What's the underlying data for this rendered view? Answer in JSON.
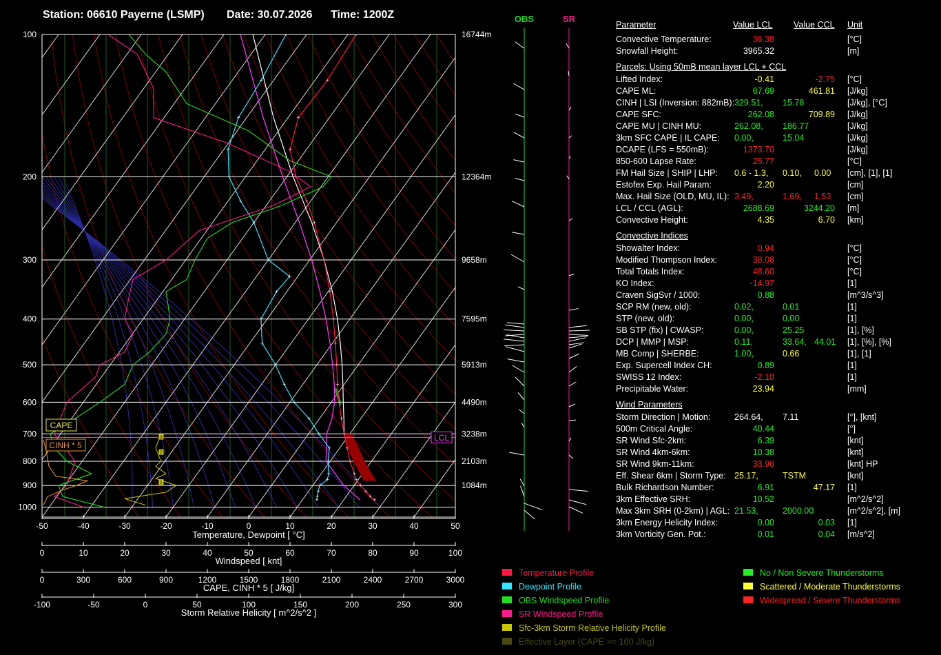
{
  "header": {
    "station": "Station: 06610 Payerne (LSMP)",
    "date": "Date: 30.07.2026",
    "time": "Time: 1200Z"
  },
  "colors": {
    "temperature": "#ff1744",
    "dewpoint": "#33e6ff",
    "obs_wind": "#22dd22",
    "sr_wind": "#ff1a8c",
    "srh": "#c8c800",
    "effective_layer": "#4a4a10",
    "green": "#22ee22",
    "yellow": "#ffff33",
    "red": "#ff2222",
    "parcel": "#ff33ff",
    "cape_fill": "#990000"
  },
  "chart_data": {
    "type": "skew-t",
    "title": "",
    "pressure_levels": [
      100,
      200,
      300,
      400,
      500,
      600,
      700,
      800,
      900,
      1000
    ],
    "height_labels": [
      {
        "p": 100,
        "label": "16744m"
      },
      {
        "p": 200,
        "label": "12364m"
      },
      {
        "p": 300,
        "label": "9658m"
      },
      {
        "p": 400,
        "label": "7595m"
      },
      {
        "p": 500,
        "label": "5913m"
      },
      {
        "p": 600,
        "label": "4490m"
      },
      {
        "p": 700,
        "label": "3238m"
      },
      {
        "p": 800,
        "label": "2103m"
      },
      {
        "p": 900,
        "label": "1084m"
      }
    ],
    "xlim": [
      -50,
      50
    ],
    "x_ticks": [
      -50,
      -40,
      -30,
      -20,
      -10,
      0,
      10,
      20,
      30,
      40,
      50
    ],
    "xlabel": "Temperature, Dewpoint  [ °C]",
    "axis_windspeed": {
      "label": "Windspeed  [ knt]",
      "ticks": [
        0,
        10,
        20,
        30,
        40,
        50,
        60,
        70,
        80,
        90,
        100
      ]
    },
    "axis_cape": {
      "label": "CAPE, CINH * 5  [ J/kg]",
      "ticks": [
        0,
        300,
        600,
        900,
        1200,
        1500,
        1800,
        2100,
        2400,
        2700,
        3000
      ]
    },
    "axis_srh": {
      "label": "Storm Relative Helicity  [ m^2/s^2 ]",
      "ticks": [
        -100,
        -50,
        0,
        50,
        100,
        150,
        200,
        250,
        300
      ]
    },
    "series": [
      {
        "name": "Temperature Profile",
        "points": [
          [
            966,
            27.5
          ],
          [
            950,
            25.8
          ],
          [
            925,
            23.8
          ],
          [
            900,
            21.6
          ],
          [
            875,
            19.5
          ],
          [
            850,
            18.0
          ],
          [
            800,
            14.8
          ],
          [
            750,
            11.8
          ],
          [
            700,
            8.6
          ],
          [
            650,
            5.3
          ],
          [
            600,
            1.9
          ],
          [
            550,
            -1.6
          ],
          [
            500,
            -5.2
          ],
          [
            450,
            -9.3
          ],
          [
            400,
            -14.0
          ],
          [
            350,
            -19.6
          ],
          [
            300,
            -26.5
          ],
          [
            250,
            -35.4
          ],
          [
            225,
            -41.0
          ],
          [
            200,
            -47.8
          ],
          [
            175,
            -54.0
          ],
          [
            150,
            -57.5
          ],
          [
            125,
            -57.0
          ],
          [
            100,
            -58.0
          ]
        ]
      },
      {
        "name": "Dewpoint Profile",
        "points": [
          [
            966,
            13.5
          ],
          [
            950,
            13.0
          ],
          [
            925,
            12.3
          ],
          [
            900,
            11.7
          ],
          [
            875,
            12.5
          ],
          [
            850,
            11.8
          ],
          [
            800,
            9.5
          ],
          [
            750,
            7.5
          ],
          [
            700,
            2.5
          ],
          [
            650,
            -2.5
          ],
          [
            600,
            -9.0
          ],
          [
            550,
            -14.5
          ],
          [
            500,
            -20.0
          ],
          [
            450,
            -27.0
          ],
          [
            400,
            -31.5
          ],
          [
            350,
            -32.5
          ],
          [
            325,
            -32.0
          ],
          [
            300,
            -40.0
          ],
          [
            250,
            -50.0
          ],
          [
            225,
            -57.0
          ],
          [
            200,
            -64.0
          ],
          [
            175,
            -69.0
          ],
          [
            150,
            -72.0
          ],
          [
            125,
            -73.0
          ],
          [
            100,
            -75.0
          ]
        ]
      }
    ],
    "lcl_label": "LCL",
    "cape_label": "CAPE",
    "cinh_label": "CINH * 5"
  },
  "hodograph": {
    "obs_label": "OBS",
    "sr_label": "SR"
  },
  "table": {
    "head": {
      "param": "Parameter",
      "lcl": "Value LCL",
      "ccl": "Value CCL",
      "unit": "Unit"
    },
    "groups": [
      {
        "rows": [
          {
            "label": "Convective Temperature:",
            "v1": "36.38",
            "c1": "red",
            "v2": "",
            "c2": "",
            "unit": "[°C]"
          },
          {
            "label": "Snowfall Height:",
            "v1": "3965.32",
            "c1": "white",
            "v2": "",
            "c2": "",
            "unit": "[m]"
          }
        ]
      },
      {
        "title": "Parcels: Using 50mB mean layer LCL + CCL",
        "rows": [
          {
            "label": "Lifted Index:",
            "v1": "-0.41",
            "c1": "yellow",
            "v2": "-2.75",
            "c2": "red",
            "unit": "[°C]"
          },
          {
            "label": "CAPE ML:",
            "v1": "67.69",
            "c1": "green",
            "v2": "461.81",
            "c2": "yellow",
            "unit": "[J/kg]"
          },
          {
            "label": "CINH | LSI (Inversion: 882mB):",
            "v1": "329.51,",
            "c1": "green",
            "v1b": "15.78",
            "unit": "[J/kg], [°C]"
          },
          {
            "label": "CAPE SFC:",
            "v1": "262.08",
            "c1": "green",
            "v2": "709.89",
            "c2": "yellow",
            "unit": "[J/kg]"
          },
          {
            "label": "CAPE MU | CINH MU:",
            "v1": "262.08,",
            "c1": "green",
            "v1b": "186.77",
            "unit": "[J/kg]"
          },
          {
            "label": "3km SFC CAPE | IL CAPE:",
            "v1": "0.00,",
            "c1": "green",
            "v1b": "15.04",
            "unit": "[J/kg]"
          },
          {
            "label": "DCAPE (LFS = 550mB):",
            "v1": "1373.70",
            "c1": "red",
            "v2": "",
            "c2": "",
            "unit": "[J/kg]"
          },
          {
            "label": "850-600 Lapse Rate:",
            "v1": "25.77",
            "c1": "red",
            "v2": "",
            "c2": "",
            "unit": "[°C]"
          },
          {
            "label": "FM Hail Size | SHIP | LHP:",
            "v1": "0.6 - 1.3,",
            "c1": "yellow",
            "v1b": "0.10,",
            "v1c": "0.00",
            "unit": "[cm], [1], [1]"
          },
          {
            "label": "Estofex Exp. Hail Param:",
            "v1": "2.20",
            "c1": "yellow",
            "v2": "",
            "c2": "",
            "unit": "[cm]"
          },
          {
            "label": "Max. Hail Size (OLD, MU, IL):",
            "v1": "3.49,",
            "c1": "red",
            "v1b": "1.69,",
            "v1c": "1.53",
            "unit": "[cm]"
          },
          {
            "label": "LCL / CCL (AGL):",
            "v1": "2688.69",
            "c1": "green",
            "v2": "3244.20",
            "c2": "green",
            "unit": "[m]"
          },
          {
            "label": "Convective Height:",
            "v1": "4.35",
            "c1": "yellow",
            "v2": "6.70",
            "c2": "yellow",
            "unit": "[km]"
          }
        ]
      },
      {
        "title": "Convective Indices",
        "rows": [
          {
            "label": "Showalter Index:",
            "v1": "0.94",
            "c1": "red",
            "v2": "",
            "c2": "",
            "unit": "[°C]"
          },
          {
            "label": "Modified Thompson Index:",
            "v1": "38.08",
            "c1": "red",
            "v2": "",
            "c2": "",
            "unit": "[°C]"
          },
          {
            "label": "Total Totals Index:",
            "v1": "48.60",
            "c1": "red",
            "v2": "",
            "c2": "",
            "unit": "[°C]"
          },
          {
            "label": "KO Index:",
            "v1": "-14.97",
            "c1": "red",
            "v2": "",
            "c2": "",
            "unit": "[1]"
          },
          {
            "label": "Craven SigSvr / 1000:",
            "v1": "0.88",
            "c1": "green",
            "v2": "",
            "c2": "",
            "unit": "[m^3/s^3]"
          },
          {
            "label": "SCP RM (new, old):",
            "v1": "0.02,",
            "c1": "green",
            "v1b": "0.01",
            "unit": "[1]"
          },
          {
            "label": "STP (new, old):",
            "v1": "0.00,",
            "c1": "green",
            "v1b": "0.00",
            "unit": "[1]"
          },
          {
            "label": "SB STP (fix) | CWASP:",
            "v1": "0.00,",
            "c1": "green",
            "v1b": "25.25",
            "unit": "[1], [%]"
          },
          {
            "label": "DCP | MMP | MSP:",
            "v1": "0.11,",
            "c1": "green",
            "v1b": "33.64,",
            "v1c": "44.01",
            "unit": "[1], [%], [%]"
          },
          {
            "label": "MB Comp | SHERBE:",
            "v1": "1.00,",
            "c1": "green",
            "v1b": "0.66",
            "v1bc": "yellow",
            "unit": "[1], [1]"
          },
          {
            "label": "Exp. Supercell Index CH:",
            "v1": "0.89",
            "c1": "green",
            "v2": "",
            "c2": "",
            "unit": "[1]"
          },
          {
            "label": "SWISS 12 Index:",
            "v1": "-2.10",
            "c1": "red",
            "v2": "",
            "c2": "",
            "unit": "[1]"
          },
          {
            "label": "Precipitable Water:",
            "v1": "23.94",
            "c1": "yellow",
            "v2": "",
            "c2": "",
            "unit": "[mm]"
          }
        ]
      },
      {
        "title": "Wind Parameters",
        "rows": [
          {
            "label": "Storm Direction | Motion:",
            "v1": "264.64,",
            "c1": "white",
            "v1b": "7.11",
            "unit": "[°], [knt]"
          },
          {
            "label": "500m Critical Angle:",
            "v1": "40.44",
            "c1": "green",
            "v2": "",
            "c2": "",
            "unit": "[°]"
          },
          {
            "label": "SR Wind Sfc-2km:",
            "v1": "6.39",
            "c1": "green",
            "v2": "",
            "c2": "",
            "unit": "[knt]"
          },
          {
            "label": "SR Wind 4km-6km:",
            "v1": "10.38",
            "c1": "green",
            "v2": "",
            "c2": "",
            "unit": "[knt]"
          },
          {
            "label": "SR Wind 9km-11km:",
            "v1": "33.96",
            "c1": "red",
            "v2": "",
            "c2": "",
            "unit": "[knt] HP"
          },
          {
            "label": "Eff. Shear 6km | Storm Type:",
            "v1": "25.17,",
            "c1": "yellow",
            "v1b": "TSTM",
            "v1bc": "yellow",
            "unit": "[knt]"
          },
          {
            "label": "Bulk Richardson Number:",
            "v1": "6.91",
            "c1": "green",
            "v2": "47.17",
            "c2": "yellow",
            "unit": "[1]"
          },
          {
            "label": "3km Effective SRH:",
            "v1": "10.52",
            "c1": "green",
            "v2": "",
            "c2": "",
            "unit": "[m^2/s^2]"
          },
          {
            "label": "Max 3km SRH (0-2km) | AGL:",
            "v1": "21.53,",
            "c1": "green",
            "v1b": "2000.00",
            "unit": "[m^2/s^2], [m]"
          },
          {
            "label": "3km Energy Helicity Index:",
            "v1": "0.00",
            "c1": "green",
            "v2": "0.03",
            "c2": "green",
            "unit": "[1]"
          },
          {
            "label": "3km Vorticity Gen. Pot.:",
            "v1": "0.01",
            "c1": "green",
            "v2": "0.04",
            "c2": "green",
            "unit": "[m/s^2]"
          }
        ]
      }
    ]
  },
  "legend_left": [
    {
      "label": "Temperature Profile",
      "color": "#ff1744"
    },
    {
      "label": "Dewpoint Profile",
      "color": "#33e6ff"
    },
    {
      "label": "OBS Windspeed Profile",
      "color": "#22dd22"
    },
    {
      "label": "SR Windspeed Profile",
      "color": "#ff1a8c"
    },
    {
      "label": "Sfc-3km Storm Relative Helicity Profile",
      "color": "#c8c800"
    },
    {
      "label": "Effective Layer (CAPE >= 100 J/kg)",
      "color": "#4a4a10"
    }
  ],
  "legend_right": [
    {
      "label": "No / Non Severe Thunderstorms",
      "color": "#22ee22"
    },
    {
      "label": "Scattered / Moderate Thunderstorms",
      "color": "#ffff33"
    },
    {
      "label": "Widespread / Severe Thunderstorms",
      "color": "#ff2222"
    }
  ]
}
